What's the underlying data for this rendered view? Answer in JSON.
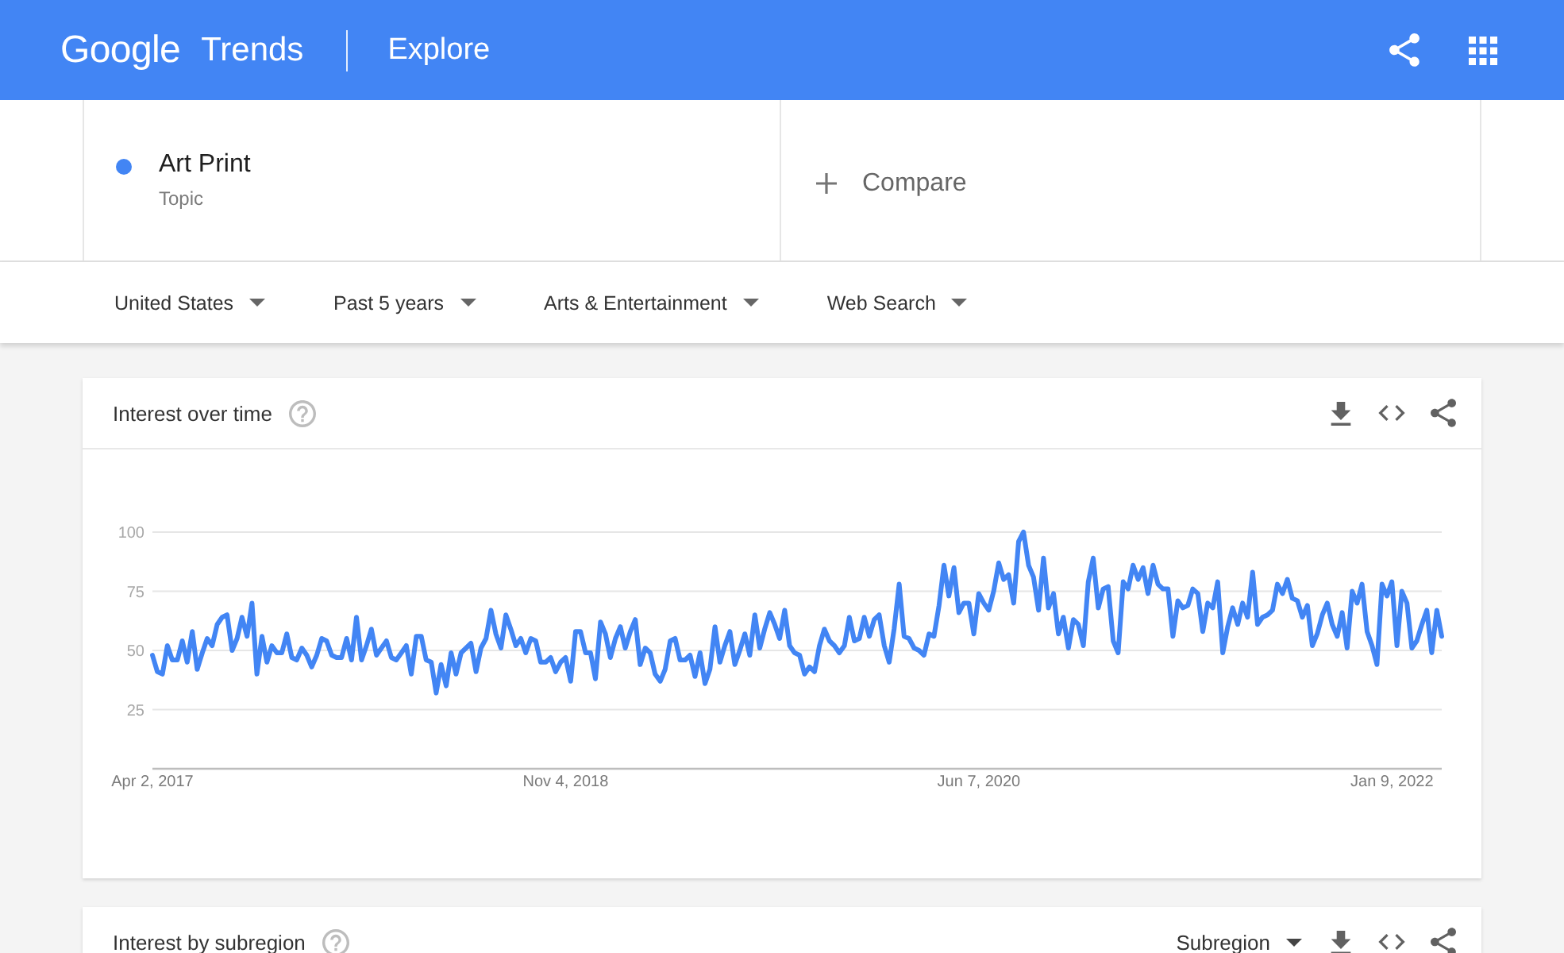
{
  "header": {
    "logo": "Google",
    "product": "Trends",
    "page": "Explore"
  },
  "terms": [
    {
      "name": "Art Print",
      "category": "Topic",
      "color": "#4285f4"
    }
  ],
  "compare": {
    "placeholder": "Compare"
  },
  "filters": [
    "United States",
    "Past 5 years",
    "Arts & Entertainment",
    "Web Search"
  ],
  "cards": [
    {
      "title": "Interest over time",
      "chart_data": {
        "type": "line",
        "grid": true,
        "categories": [
          "Apr 2, 2017",
          null,
          null,
          null,
          null,
          null,
          null,
          null,
          null,
          null,
          null,
          null,
          null,
          null,
          null,
          null,
          null,
          null,
          null,
          null,
          null,
          null,
          null,
          null,
          null,
          null,
          null,
          null,
          null,
          null,
          null,
          null,
          null,
          null,
          null,
          null,
          null,
          null,
          null,
          null,
          null,
          null,
          null,
          null,
          null,
          null,
          null,
          null,
          null,
          null,
          null,
          null,
          null,
          null,
          null,
          null,
          null,
          null,
          null,
          null,
          null,
          null,
          null,
          null,
          null,
          null,
          null,
          null,
          null,
          null,
          null,
          null,
          null,
          null,
          null,
          null,
          null,
          null,
          null,
          null,
          null,
          null,
          null,
          "Nov 4, 2018",
          null,
          null,
          null,
          null,
          null,
          null,
          null,
          null,
          null,
          null,
          null,
          null,
          null,
          null,
          null,
          null,
          null,
          null,
          null,
          null,
          null,
          null,
          null,
          null,
          null,
          null,
          null,
          null,
          null,
          null,
          null,
          null,
          null,
          null,
          null,
          null,
          null,
          null,
          null,
          null,
          null,
          null,
          null,
          null,
          null,
          null,
          null,
          null,
          null,
          null,
          null,
          null,
          null,
          null,
          null,
          null,
          null,
          null,
          null,
          null,
          null,
          null,
          null,
          null,
          null,
          null,
          null,
          null,
          null,
          null,
          null,
          null,
          null,
          null,
          null,
          null,
          null,
          null,
          null,
          null,
          null,
          null,
          "Jun 7, 2020",
          null,
          null,
          null,
          null,
          null,
          null,
          null,
          null,
          null,
          null,
          null,
          null,
          null,
          null,
          null,
          null,
          null,
          null,
          null,
          null,
          null,
          null,
          null,
          null,
          null,
          null,
          null,
          null,
          null,
          null,
          null,
          null,
          null,
          null,
          null,
          null,
          null,
          null,
          null,
          null,
          null,
          null,
          null,
          null,
          null,
          null,
          null,
          null,
          null,
          null,
          null,
          null,
          null,
          null,
          null,
          null,
          null,
          null,
          null,
          null,
          null,
          null,
          null,
          null,
          null,
          null,
          null,
          null,
          null,
          null,
          null,
          null,
          null,
          null,
          null,
          null,
          null,
          null,
          null,
          null,
          null,
          null,
          "Jan 9, 2022",
          null,
          null,
          null,
          null,
          null,
          null,
          null,
          null,
          null,
          null
        ],
        "series": [
          {
            "color": "#4285f4",
            "values": [
              48,
              41,
              40,
              52,
              46,
              46,
              54,
              45,
              58,
              42,
              49,
              55,
              52,
              61,
              64,
              65,
              50,
              55,
              64,
              56,
              70,
              40,
              56,
              45,
              52,
              49,
              49,
              57,
              47,
              46,
              51,
              48,
              43,
              48,
              55,
              54,
              48,
              47,
              47,
              55,
              46,
              64,
              46,
              52,
              59,
              48,
              51,
              54,
              47,
              46,
              49,
              52,
              40,
              56,
              56,
              46,
              45,
              32,
              44,
              35,
              49,
              40,
              49,
              51,
              53,
              41,
              51,
              55,
              67,
              57,
              51,
              65,
              59,
              52,
              55,
              49,
              55,
              54,
              45,
              45,
              47,
              41,
              45,
              47,
              37,
              58,
              58,
              49,
              49,
              38,
              62,
              57,
              47,
              55,
              60,
              51,
              58,
              63,
              44,
              51,
              49,
              40,
              37,
              42,
              54,
              55,
              46,
              46,
              48,
              39,
              49,
              36,
              42,
              60,
              45,
              52,
              58,
              44,
              50,
              57,
              48,
              65,
              51,
              59,
              66,
              61,
              55,
              67,
              52,
              49,
              48,
              40,
              43,
              41,
              52,
              59,
              54,
              52,
              49,
              52,
              64,
              54,
              55,
              64,
              56,
              63,
              65,
              52,
              45,
              59,
              78,
              56,
              55,
              51,
              50,
              48,
              57,
              56,
              69,
              86,
              73,
              85,
              66,
              70,
              70,
              57,
              74,
              70,
              67,
              75,
              87,
              80,
              82,
              70,
              96,
              100,
              86,
              81,
              67,
              89,
              68,
              74,
              57,
              64,
              51,
              63,
              61,
              52,
              79,
              89,
              68,
              76,
              77,
              54,
              49,
              79,
              76,
              86,
              80,
              85,
              74,
              86,
              78,
              76,
              76,
              56,
              71,
              68,
              69,
              76,
              74,
              58,
              70,
              68,
              79,
              49,
              60,
              68,
              61,
              70,
              64,
              83,
              61,
              64,
              65,
              67,
              78,
              74,
              80,
              72,
              71,
              64,
              69,
              52,
              57,
              65,
              70,
              61,
              56,
              66,
              51,
              75,
              70,
              78,
              58,
              52,
              44,
              78,
              73,
              79,
              52,
              75,
              70,
              51,
              54,
              61,
              67,
              49,
              67,
              56
            ]
          }
        ],
        "ylim": [
          0,
          100
        ],
        "yticks": [
          25,
          50,
          75,
          100
        ]
      }
    },
    {
      "title": "Interest by subregion",
      "dropdown": "Subregion"
    }
  ]
}
